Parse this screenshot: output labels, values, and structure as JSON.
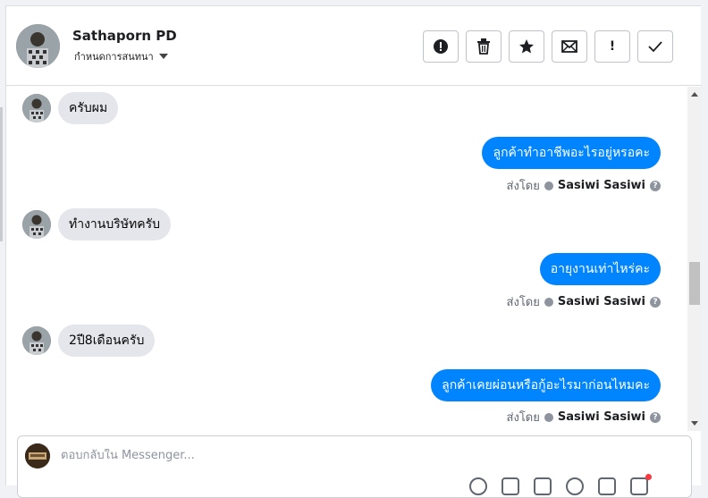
{
  "header": {
    "contact_name": "Sathaporn PD",
    "subtitle": "กำหนดการสนทนา",
    "actions": [
      {
        "icon": "alert-circle-icon"
      },
      {
        "icon": "trash-icon"
      },
      {
        "icon": "star-icon"
      },
      {
        "icon": "mail-icon"
      },
      {
        "icon": "exclamation-icon",
        "glyph": "!"
      },
      {
        "icon": "check-icon"
      }
    ]
  },
  "messages": [
    {
      "direction": "in",
      "text": "ครับผม"
    },
    {
      "direction": "out",
      "text": "ลูกค้าทำอาชีพอะไรอยู่หรอคะ",
      "sent_label": "ส่งโดย",
      "sender": "Sasiwi Sasiwi"
    },
    {
      "direction": "in",
      "text": "ทำงานบริษัทครับ"
    },
    {
      "direction": "out",
      "text": "อายุงานเท่าไหร่คะ",
      "sent_label": "ส่งโดย",
      "sender": "Sasiwi Sasiwi"
    },
    {
      "direction": "in",
      "text": "2ปี8เดือนครับ"
    },
    {
      "direction": "out",
      "text": "ลูกค้าเคยผ่อนหรือกู้อะไรมาก่อนไหมคะ",
      "sent_label": "ส่งโดย",
      "sender": "Sasiwi Sasiwi"
    }
  ],
  "composer": {
    "placeholder": "ตอบกลับใน Messenger..."
  },
  "colors": {
    "outgoing_bubble": "#0084ff",
    "incoming_bubble": "#e4e6eb",
    "notification_dot": "#fa383e"
  }
}
